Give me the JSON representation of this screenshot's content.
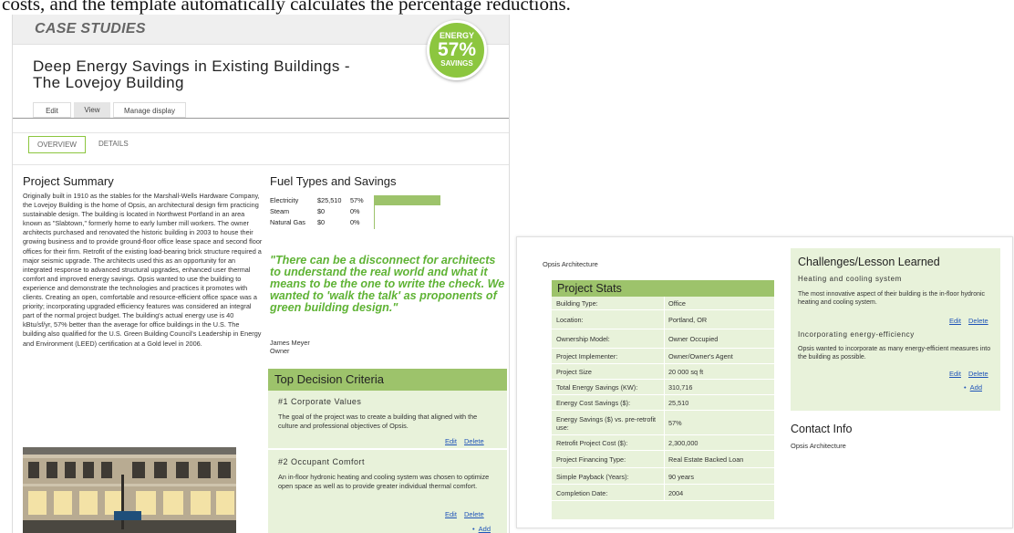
{
  "caption": "costs, and the template automatically calculates the percentage reductions.",
  "left": {
    "section_label": "CASE STUDIES",
    "badge": {
      "top": "ENERGY",
      "value": "57%",
      "bottom": "SAVINGS",
      "color": "#8cc63f"
    },
    "title_line1": "Deep Energy Savings in Existing Buildings -",
    "title_line2": "The Lovejoy Building",
    "admin_tabs": {
      "edit": "Edit",
      "view": "View",
      "manage": "Manage display"
    },
    "subtabs": {
      "overview": "OVERVIEW",
      "details": "DETAILS"
    },
    "project_summary": {
      "heading": "Project Summary",
      "body": "Originally built in 1910 as the stables for the Marshall-Wells Hardware Company, the Lovejoy Building is the home of Opsis, an architectural design firm practicing sustainable design. The building is located in Northwest Portland in an area known as \"Slabtown,\" formerly home to early lumber mill workers. The owner architects purchased and renovated the historic building in 2003 to house their growing business and to provide ground-floor office lease space and second floor offices for their firm. Retrofit of the existing load-bearing brick structure required a major seismic upgrade. The architects used this as an opportunity for an integrated response to advanced structural upgrades, enhanced user thermal comfort and improved energy savings. Opsis wanted to use the building to experience and demonstrate the technologies and practices it promotes with clients. Creating an open, comfortable and resource-efficient office space was a priority; incorporating upgraded efficiency features was considered an integral part of the normal project budget. The building's actual energy use is 40 kBtu/sf/yr, 57% better than the average for office buildings in the U.S. The building also qualified for the U.S. Green Building Council's Leadership in Energy and Environment (LEED) certification at a Gold level in 2006."
    },
    "fuel": {
      "heading": "Fuel Types and Savings",
      "rows": [
        {
          "name": "Electricity",
          "value": "$25,510",
          "pct": "57%",
          "fraction": 0.57
        },
        {
          "name": "Steam",
          "value": "$0",
          "pct": "0%",
          "fraction": 0
        },
        {
          "name": "Natural Gas",
          "value": "$0",
          "pct": "0%",
          "fraction": 0
        }
      ]
    },
    "quote": {
      "text": "\"There can be a disconnect for architects to understand the real world and what it means to be the one to write the check. We wanted to 'walk the talk' as proponents of green building design.\"",
      "name": "James Meyer",
      "role": "Owner"
    },
    "decision": {
      "heading": "Top Decision Criteria",
      "item1_title": "#1 Corporate Values",
      "item1_text": "The goal of the project was to create a building that aligned with the culture and professional objectives of Opsis.",
      "item2_title": "#2 Occupant Comfort",
      "item2_text": "An in-floor hydronic heating and cooling system was chosen to optimize open space as well as to provide greater individual thermal comfort.",
      "edit": "Edit",
      "delete": "Delete",
      "add": "Add"
    }
  },
  "right": {
    "arch_label": "Opsis Architecture",
    "stats": {
      "heading": "Project Stats",
      "rows": [
        {
          "key": "Building Type:",
          "value": "Office"
        },
        {
          "key": "Location:",
          "value": "Portland, OR"
        },
        {
          "key": "Ownership Model:",
          "value": "Owner Occupied"
        },
        {
          "key": "Project Implementer:",
          "value": "Owner/Owner's Agent"
        },
        {
          "key": "Project Size",
          "value": "20 000 sq ft"
        },
        {
          "key": "Total Energy Savings (KW):",
          "value": "310,716"
        },
        {
          "key": "Energy Cost Savings ($):",
          "value": "25,510"
        },
        {
          "key": "Energy Savings ($) vs. pre-retrofit use:",
          "value": "57%"
        },
        {
          "key": "Retrofit Project Cost ($):",
          "value": "2,300,000"
        },
        {
          "key": "Project Financing Type:",
          "value": "Real Estate Backed Loan"
        },
        {
          "key": "Simple Payback (Years):",
          "value": "90 years"
        },
        {
          "key": "Completion Date:",
          "value": "2004"
        }
      ]
    },
    "challenges": {
      "heading": "Challenges/Lesson Learned",
      "item1_title": "Heating and cooling system",
      "item1_text": "The most innovative aspect of their building is the in-floor hydronic heating and cooling system.",
      "item2_title": "Incorporating energy-efficiency",
      "item2_text": "Opsis wanted to incorporate as many energy-efficient measures into the building as possible.",
      "edit": "Edit",
      "delete": "Delete",
      "add": "Add"
    },
    "contact": {
      "heading": "Contact Info",
      "value": "Opsis Architecture"
    }
  }
}
